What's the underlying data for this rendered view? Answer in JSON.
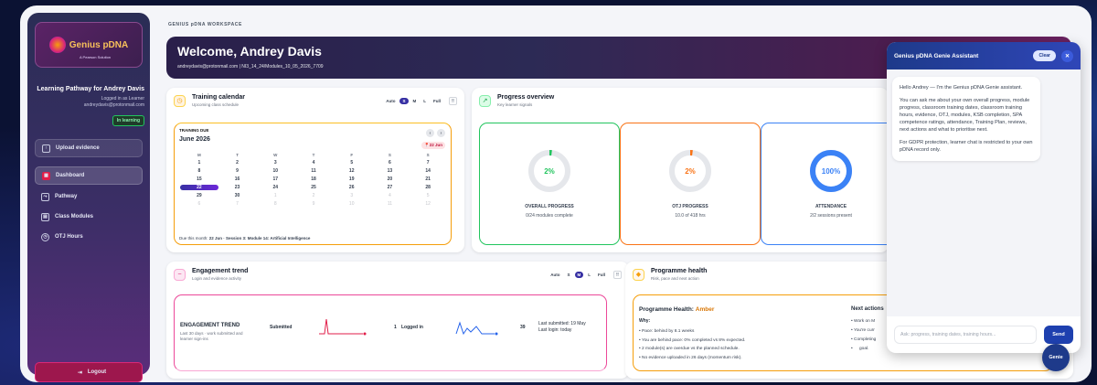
{
  "sidebar": {
    "logo_text": "Genius pDNA",
    "logo_sub": "A Pearson Solution",
    "pathway_title": "Learning Pathway for Andrey Davis",
    "logged_in": "Logged in as Learner",
    "email": "andreydavis@protonmail.com",
    "status_badge": "In learning",
    "upload_label": "Upload evidence",
    "nav": [
      "Dashboard",
      "Pathway",
      "Class Modules",
      "OTJ Hours"
    ],
    "logout_label": "Logout"
  },
  "workspace_label": "GENIUS pDNA WORKSPACE",
  "hero": {
    "title": "Welcome, Andrey Davis",
    "meta": "andreydavis@protonmail.com | NI3_14_24/Modules_10_05_2026_7709"
  },
  "calendar": {
    "title": "Training calendar",
    "subtitle": "Upcoming class schedule",
    "sizes": [
      "Auto",
      "S",
      "M",
      "L",
      "Full"
    ],
    "active_size": "S",
    "due_label": "TRAINING DUE",
    "month": "June 2026",
    "pin": "22 Jun",
    "weekdays": [
      "M",
      "T",
      "W",
      "T",
      "F",
      "S",
      "S"
    ],
    "days": [
      [
        "1",
        "2",
        "3",
        "4",
        "5",
        "6",
        "7"
      ],
      [
        "8",
        "9",
        "10",
        "11",
        "12",
        "13",
        "14"
      ],
      [
        "15",
        "16",
        "17",
        "18",
        "19",
        "20",
        "21"
      ],
      [
        "22",
        "23",
        "24",
        "25",
        "26",
        "27",
        "28"
      ],
      [
        "29",
        "30",
        "1",
        "2",
        "3",
        "4",
        "5"
      ],
      [
        "6",
        "7",
        "8",
        "9",
        "10",
        "11",
        "12"
      ]
    ],
    "selected": "22",
    "footer_prefix": "Due this month: ",
    "footer_value": "22 Jun · Session 3: Module 14: Artificial Intelligence"
  },
  "progress": {
    "title": "Progress overview",
    "subtitle": "Key learner signals",
    "items": [
      {
        "value": "2%",
        "fraction": 0.02,
        "label": "OVERALL PROGRESS",
        "sub": "0/24 modules complete",
        "color": "#22c55e"
      },
      {
        "value": "2%",
        "fraction": 0.02,
        "label": "OTJ PROGRESS",
        "sub": "10.0 of 418 hrs",
        "color": "#f97316"
      },
      {
        "value": "100%",
        "fraction": 1.0,
        "label": "ATTENDANCE",
        "sub": "2/2 sessions present",
        "color": "#3b82f6"
      }
    ]
  },
  "engagement": {
    "title": "Engagement trend",
    "subtitle": "Login and evidence activity",
    "sizes": [
      "Auto",
      "S",
      "M",
      "L",
      "Full"
    ],
    "active_size": "M",
    "box_title": "ENGAGEMENT TREND",
    "box_sub": "Last 30 days · work submitted and learner sign-ins",
    "submitted_label": "Submitted",
    "logged_label": "Logged in",
    "logged_count": "1",
    "count2": "39",
    "last_submitted": "Last submitted: 19 May",
    "last_login": "Last login: today"
  },
  "programme": {
    "title": "Programme health",
    "subtitle": "Risk, pace and next action",
    "health_prefix": "Programme Health: ",
    "health_value": "Amber",
    "why": "Why:",
    "reasons": [
      "Pace: behind by 8.1 weeks",
      "You are behind pace: 0% completed vs 8% expected.",
      "2 module(s) are overdue vs the planned schedule.",
      "No evidence uploaded in 26 days (momentum risk)."
    ],
    "next_title": "Next actions",
    "next": [
      "Work on M",
      "You're curr",
      "Completing",
      "goal."
    ]
  },
  "genie": {
    "title": "Genius pDNA Genie Assistant",
    "clear": "Clear",
    "messages": [
      "Hello Andrey — I'm the Genius pDNA Genie assistant.",
      "You can ask me about your own overall progress, module progress, classroom training dates, classroom training hours, evidence, OTJ, modules, KSB completion, SPA competence ratings, attendance, Training Plan, reviews, next actions and what to prioritise next.",
      "For GDPR protection, learner chat is restricted to your own pDNA record only."
    ],
    "placeholder": "Ask: progress, training dates, training hours...",
    "send": "Send",
    "fab": "Genie"
  }
}
